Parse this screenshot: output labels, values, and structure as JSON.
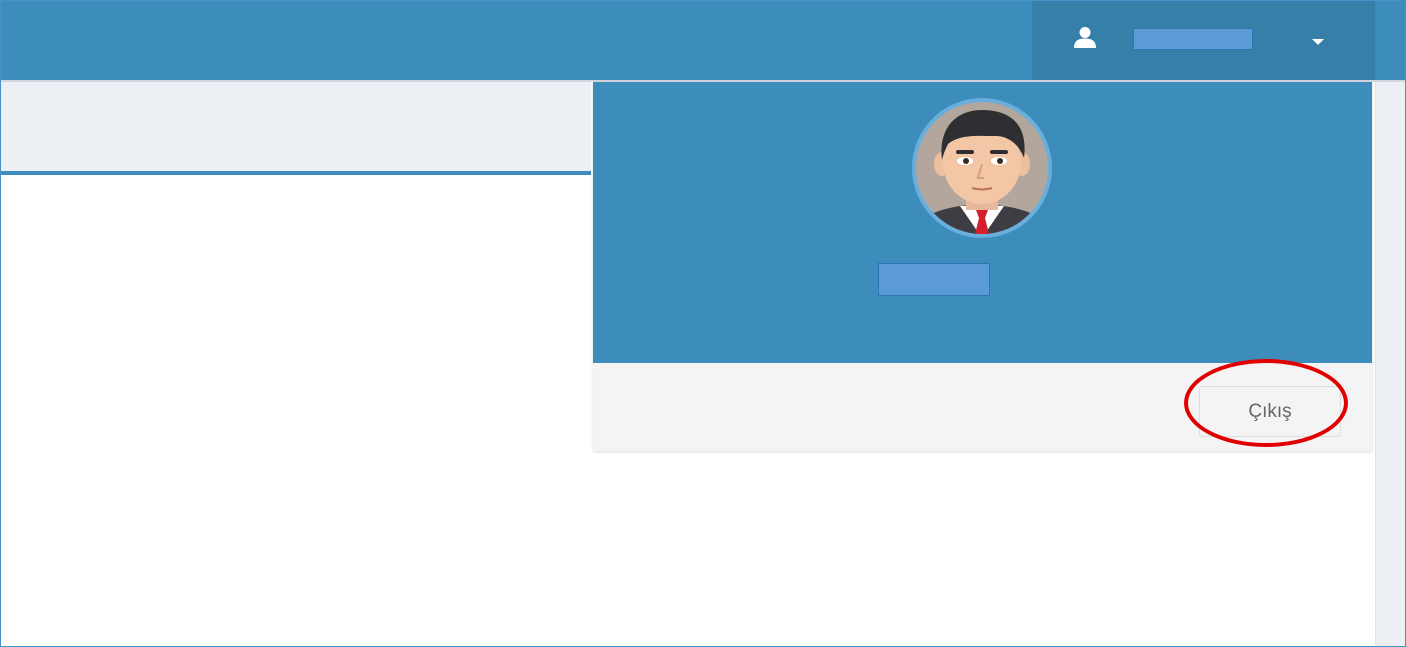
{
  "header": {
    "user_menu": {
      "user_icon": "user-icon",
      "caret_icon": "caret-down-icon",
      "username_redacted": true
    }
  },
  "dropdown": {
    "avatar": "avatar-image",
    "profile_name_redacted": true,
    "footer": {
      "logout_label": "Çıkış"
    }
  },
  "annotation": {
    "highlight_color": "#e00000",
    "highlight_target": "logout-button"
  },
  "colors": {
    "primary": "#3c8dbc",
    "primary_dark": "#367fa9",
    "content_bg": "#ecf0f5",
    "redaction": "#5b9bd5"
  }
}
